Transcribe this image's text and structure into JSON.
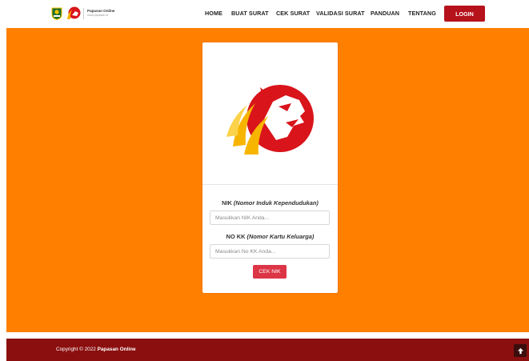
{
  "brand": {
    "name": "Papasan Online",
    "url": "www.papasan.id",
    "emblem_icon": "regency-emblem-icon",
    "logo_icon": "papasan-lion-logo-icon"
  },
  "nav": {
    "items": [
      {
        "label": "HOME"
      },
      {
        "label": "BUAT SURAT"
      },
      {
        "label": "CEK SURAT"
      },
      {
        "label": "VALIDASI SURAT"
      },
      {
        "label": "PANDUAN"
      },
      {
        "label": "TENTANG"
      }
    ],
    "login_label": "LOGIN"
  },
  "form": {
    "nik_label": "NIK",
    "nik_label_hint": "(Nomor Induk Kependudukan)",
    "nik_placeholder": "Masukkan NIK Anda...",
    "nik_value": "",
    "kk_label": "NO KK",
    "kk_label_hint": "(Nomor Kartu Keluarga)",
    "kk_placeholder": "Masukkan No KK Anda...",
    "kk_value": "",
    "submit_label": "CEK NIK"
  },
  "footer": {
    "copyright_prefix": "Copyright © 2022",
    "copyright_brand": "Papasan Online",
    "back_to_top_icon": "arrow-up-icon"
  },
  "colors": {
    "hero_background": "#ff7f00",
    "login_button": "#b5121b",
    "submit_button": "#dc3545",
    "footer_background": "#8b0f0f",
    "logo_red": "#d9141b",
    "logo_yellow": "#f7b500"
  }
}
